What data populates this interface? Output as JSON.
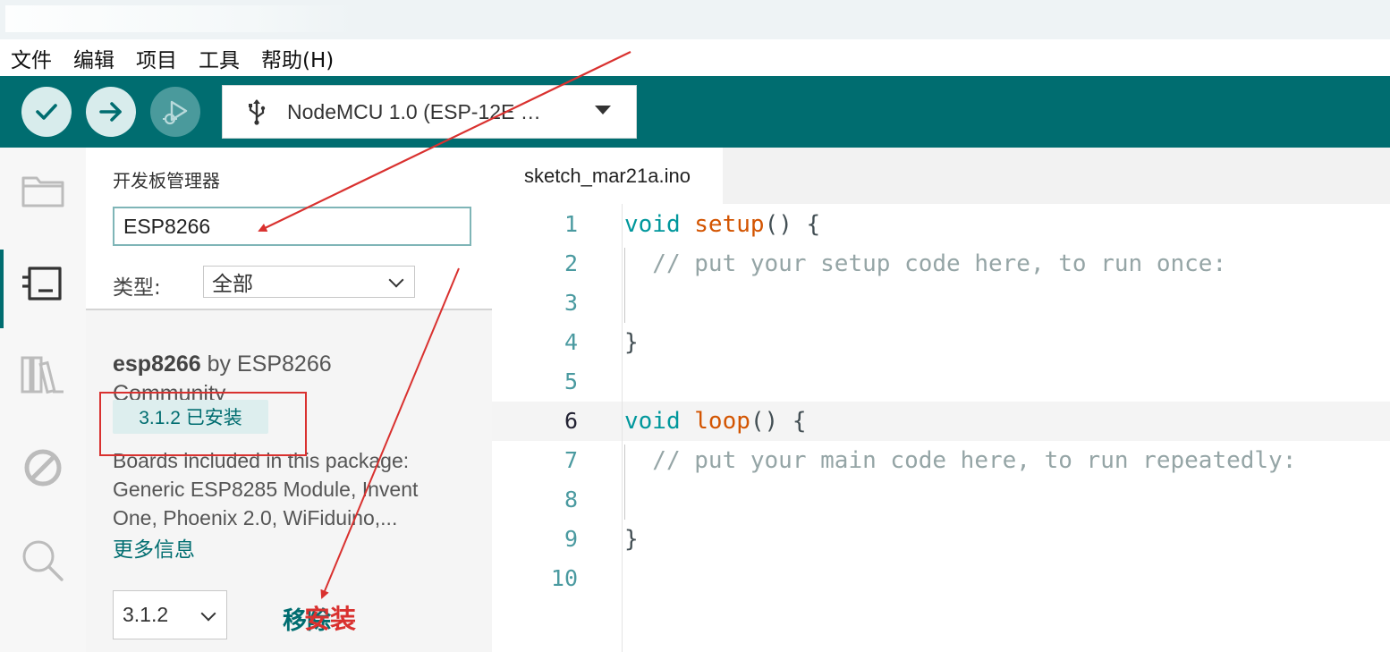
{
  "menu": [
    "文件",
    "编辑",
    "项目",
    "工具",
    "帮助(H)"
  ],
  "toolbar": {
    "verify_icon": "check-icon",
    "upload_icon": "arrow-right-icon",
    "debug_icon": "debug-icon",
    "board_icon": "usb-icon",
    "board_label": "NodeMCU 1.0 (ESP-12E …"
  },
  "rail": [
    "folder-icon",
    "board-manager-icon",
    "library-icon",
    "debug-off-icon",
    "search-icon"
  ],
  "board_manager": {
    "title": "开发板管理器",
    "search_value": "ESP8266",
    "type_label": "类型:",
    "type_value": "全部",
    "result": {
      "name": "esp8266",
      "by": "by ESP8266",
      "author": "Community",
      "installed_badge": "3.1.2 已安装",
      "description_lines": [
        "Boards included in this package:",
        "Generic ESP8285 Module, Invent",
        "One, Phoenix 2.0, WiFiduino,..."
      ],
      "more_info": "更多信息",
      "version_value": "3.1.2",
      "remove_label": "移除",
      "install_label": "安装"
    }
  },
  "editor": {
    "tab": "sketch_mar21a.ino",
    "current_line": 6,
    "lines": [
      {
        "n": "1",
        "tokens": [
          {
            "t": "void",
            "c": "kw"
          },
          {
            "t": " ",
            "c": ""
          },
          {
            "t": "setup",
            "c": "fn"
          },
          {
            "t": "() {",
            "c": ""
          }
        ]
      },
      {
        "n": "2",
        "tokens": [
          {
            "t": "  // put your setup code here, to run once:",
            "c": "cm"
          }
        ]
      },
      {
        "n": "3",
        "tokens": []
      },
      {
        "n": "4",
        "tokens": [
          {
            "t": "}",
            "c": ""
          }
        ]
      },
      {
        "n": "5",
        "tokens": []
      },
      {
        "n": "6",
        "tokens": [
          {
            "t": "void",
            "c": "kw"
          },
          {
            "t": " ",
            "c": ""
          },
          {
            "t": "loop",
            "c": "fn"
          },
          {
            "t": "() {",
            "c": ""
          }
        ]
      },
      {
        "n": "7",
        "tokens": [
          {
            "t": "  // put your main code here, to run repeatedly:",
            "c": "cm"
          }
        ]
      },
      {
        "n": "8",
        "tokens": []
      },
      {
        "n": "9",
        "tokens": [
          {
            "t": "}",
            "c": ""
          }
        ]
      },
      {
        "n": "10",
        "tokens": []
      }
    ]
  },
  "colors": {
    "toolbar": "#006d70",
    "accent": "#00979c",
    "annotation": "#d9312f"
  }
}
